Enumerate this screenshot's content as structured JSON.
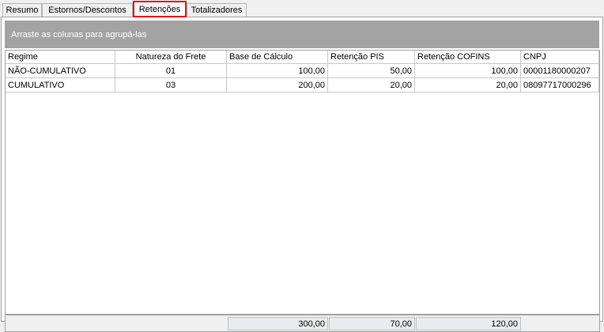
{
  "tabs": [
    {
      "label": "Resumo"
    },
    {
      "label": "Estornos/Descontos"
    },
    {
      "label": "Retenções"
    },
    {
      "label": "Totalizadores"
    }
  ],
  "group_bar_text": "Arraste as colunas para agrupá-las",
  "columns": [
    "Regime",
    "Natureza do Frete",
    "Base de Cálculo",
    "Retenção PIS",
    "Retenção COFINS",
    "CNPJ"
  ],
  "rows": [
    {
      "regime": "NÃO-CUMULATIVO",
      "natureza": "01",
      "base": "100,00",
      "pis": "50,00",
      "cofins": "100,00",
      "cnpj": "00001180000207"
    },
    {
      "regime": "CUMULATIVO",
      "natureza": "03",
      "base": "200,00",
      "pis": "20,00",
      "cofins": "20,00",
      "cnpj": "08097717000296"
    }
  ],
  "totals": {
    "base": "300,00",
    "pis": "70,00",
    "cofins": "120,00"
  },
  "colors": {
    "active_tab_border": "#e0161d",
    "group_bar": "#a3a3a3"
  }
}
